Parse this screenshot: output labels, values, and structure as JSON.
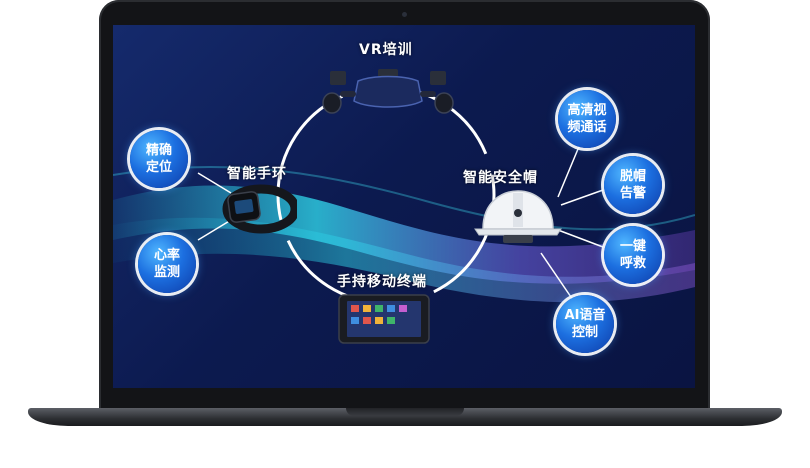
{
  "hub": {
    "top": "VR培训",
    "left": "智能手环",
    "right": "智能安全帽",
    "bottom": "手持移动终端"
  },
  "left_features": [
    {
      "line1": "精确",
      "line2": "定位"
    },
    {
      "line1": "心率",
      "line2": "监测"
    }
  ],
  "right_features": [
    {
      "line1": "高清视",
      "line2": "频通话"
    },
    {
      "line1": "脱帽",
      "line2": "告警"
    },
    {
      "line1": "一键",
      "line2": "呼救"
    },
    {
      "line1": "AI语音",
      "line2": "控制"
    }
  ],
  "colors": {
    "screen_bg": "#0c1a4f",
    "bubble_blue": "#1c6fe0",
    "wave_cyan": "#2fd3e8",
    "wave_purple": "#8a4fd8"
  }
}
